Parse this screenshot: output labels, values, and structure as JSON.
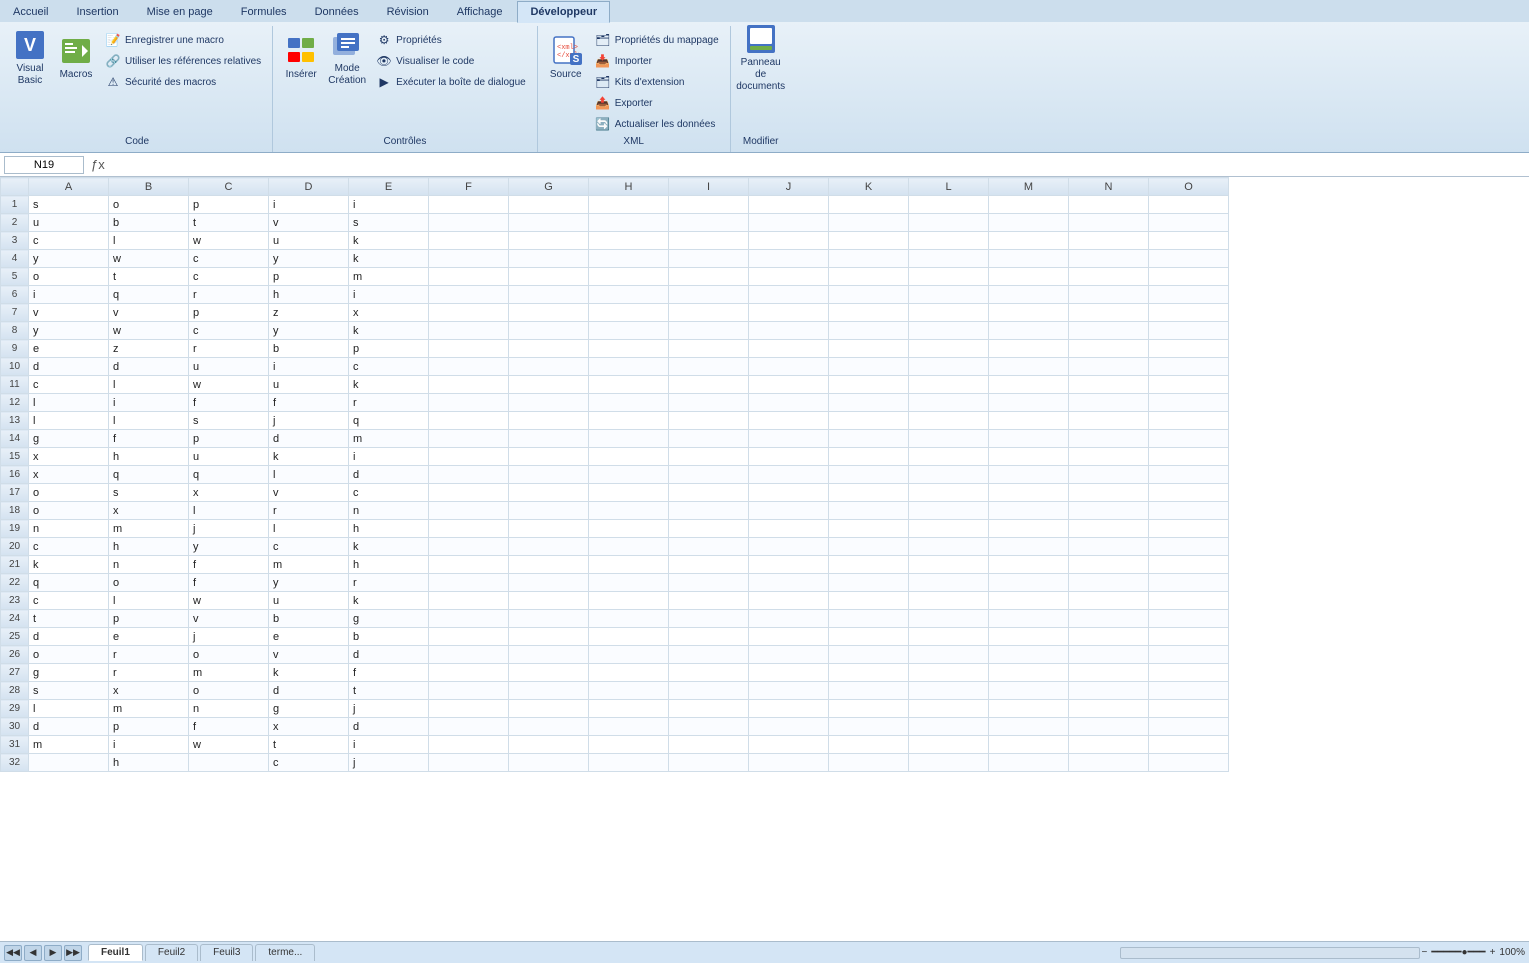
{
  "ribbon": {
    "tabs": [
      {
        "label": "Accueil",
        "active": false
      },
      {
        "label": "Insertion",
        "active": false
      },
      {
        "label": "Mise en page",
        "active": false
      },
      {
        "label": "Formules",
        "active": false
      },
      {
        "label": "Données",
        "active": false
      },
      {
        "label": "Révision",
        "active": false
      },
      {
        "label": "Affichage",
        "active": false
      },
      {
        "label": "Développeur",
        "active": true
      }
    ],
    "groups": [
      {
        "label": "Code",
        "large_buttons": [
          {
            "label": "Visual Basic",
            "icon": "🖥"
          },
          {
            "label": "Macros",
            "icon": "📋"
          }
        ],
        "small_buttons": [
          {
            "icon": "📝",
            "label": "Enregistrer une macro"
          },
          {
            "icon": "🔗",
            "label": "Utiliser les références relatives"
          },
          {
            "icon": "⚠",
            "label": "Sécurité des macros"
          }
        ]
      },
      {
        "label": "Contrôles",
        "large_buttons": [
          {
            "label": "Insérer",
            "icon": "⬜"
          },
          {
            "label": "Mode Création",
            "icon": "✏️"
          }
        ],
        "small_buttons": [
          {
            "icon": "⚙",
            "label": "Propriétés"
          },
          {
            "icon": "👁",
            "label": "Visualiser le code"
          },
          {
            "icon": "▶",
            "label": "Exécuter la boîte de dialogue"
          }
        ]
      },
      {
        "label": "XML",
        "large_buttons": [
          {
            "label": "Source",
            "icon": "📄"
          }
        ],
        "small_buttons": [
          {
            "icon": "🗂",
            "label": "Propriétés du mappage"
          },
          {
            "icon": "📥",
            "label": "Importer"
          },
          {
            "icon": "🗂",
            "label": "Kits d'extension"
          },
          {
            "icon": "📤",
            "label": "Exporter"
          },
          {
            "icon": "🔄",
            "label": "Actualiser les données"
          }
        ]
      },
      {
        "label": "Modifier",
        "large_buttons": [
          {
            "label": "Panneau de documents",
            "icon": "📋"
          }
        ],
        "small_buttons": []
      }
    ]
  },
  "formula_bar": {
    "cell_ref": "N19",
    "formula": ""
  },
  "columns": [
    "A",
    "B",
    "C",
    "D",
    "E",
    "F",
    "G",
    "H",
    "I",
    "J",
    "K",
    "L",
    "M",
    "N",
    "O"
  ],
  "rows": [
    {
      "num": 1,
      "cells": [
        "s",
        "o",
        "p",
        "i",
        "i",
        "",
        "",
        "",
        "",
        "",
        "",
        "",
        "",
        "",
        ""
      ]
    },
    {
      "num": 2,
      "cells": [
        "u",
        "b",
        "t",
        "v",
        "s",
        "",
        "",
        "",
        "",
        "",
        "",
        "",
        "",
        "",
        ""
      ]
    },
    {
      "num": 3,
      "cells": [
        "c",
        "l",
        "w",
        "u",
        "k",
        "",
        "",
        "",
        "",
        "",
        "",
        "",
        "",
        "",
        ""
      ]
    },
    {
      "num": 4,
      "cells": [
        "y",
        "w",
        "c",
        "y",
        "k",
        "",
        "",
        "",
        "",
        "",
        "",
        "",
        "",
        "",
        ""
      ]
    },
    {
      "num": 5,
      "cells": [
        "o",
        "t",
        "c",
        "p",
        "m",
        "",
        "",
        "",
        "",
        "",
        "",
        "",
        "",
        "",
        ""
      ]
    },
    {
      "num": 6,
      "cells": [
        "i",
        "q",
        "r",
        "h",
        "i",
        "",
        "",
        "",
        "",
        "",
        "",
        "",
        "",
        "",
        ""
      ]
    },
    {
      "num": 7,
      "cells": [
        "v",
        "v",
        "p",
        "z",
        "x",
        "",
        "",
        "",
        "",
        "",
        "",
        "",
        "",
        "",
        ""
      ]
    },
    {
      "num": 8,
      "cells": [
        "y",
        "w",
        "c",
        "y",
        "k",
        "",
        "",
        "",
        "",
        "",
        "",
        "",
        "",
        "",
        ""
      ]
    },
    {
      "num": 9,
      "cells": [
        "e",
        "z",
        "r",
        "b",
        "p",
        "",
        "",
        "",
        "",
        "",
        "",
        "",
        "",
        "",
        ""
      ]
    },
    {
      "num": 10,
      "cells": [
        "d",
        "d",
        "u",
        "i",
        "c",
        "",
        "",
        "",
        "",
        "",
        "",
        "",
        "",
        "",
        ""
      ]
    },
    {
      "num": 11,
      "cells": [
        "c",
        "l",
        "w",
        "u",
        "k",
        "",
        "",
        "",
        "",
        "",
        "",
        "",
        "",
        "",
        ""
      ]
    },
    {
      "num": 12,
      "cells": [
        "l",
        "i",
        "f",
        "f",
        "r",
        "",
        "",
        "",
        "",
        "",
        "",
        "",
        "",
        "",
        ""
      ]
    },
    {
      "num": 13,
      "cells": [
        "l",
        "l",
        "s",
        "j",
        "q",
        "",
        "",
        "",
        "",
        "",
        "",
        "",
        "",
        "",
        ""
      ]
    },
    {
      "num": 14,
      "cells": [
        "g",
        "f",
        "p",
        "d",
        "m",
        "",
        "",
        "",
        "",
        "",
        "",
        "",
        "",
        "",
        ""
      ]
    },
    {
      "num": 15,
      "cells": [
        "x",
        "h",
        "u",
        "k",
        "i",
        "",
        "",
        "",
        "",
        "",
        "",
        "",
        "",
        "",
        ""
      ]
    },
    {
      "num": 16,
      "cells": [
        "x",
        "q",
        "q",
        "l",
        "d",
        "",
        "",
        "",
        "",
        "",
        "",
        "",
        "",
        "",
        ""
      ]
    },
    {
      "num": 17,
      "cells": [
        "o",
        "s",
        "x",
        "v",
        "c",
        "",
        "",
        "",
        "",
        "",
        "",
        "",
        "",
        "",
        ""
      ]
    },
    {
      "num": 18,
      "cells": [
        "o",
        "x",
        "l",
        "r",
        "n",
        "",
        "",
        "",
        "",
        "",
        "",
        "",
        "",
        "",
        ""
      ]
    },
    {
      "num": 19,
      "cells": [
        "n",
        "m",
        "j",
        "l",
        "h",
        "",
        "",
        "",
        "",
        "",
        "",
        "",
        "",
        "",
        ""
      ]
    },
    {
      "num": 20,
      "cells": [
        "c",
        "h",
        "y",
        "c",
        "k",
        "",
        "",
        "",
        "",
        "",
        "",
        "",
        "",
        "",
        ""
      ]
    },
    {
      "num": 21,
      "cells": [
        "k",
        "n",
        "f",
        "m",
        "h",
        "",
        "",
        "",
        "",
        "",
        "",
        "",
        "",
        "",
        ""
      ]
    },
    {
      "num": 22,
      "cells": [
        "q",
        "o",
        "f",
        "y",
        "r",
        "",
        "",
        "",
        "",
        "",
        "",
        "",
        "",
        "",
        ""
      ]
    },
    {
      "num": 23,
      "cells": [
        "c",
        "l",
        "w",
        "u",
        "k",
        "",
        "",
        "",
        "",
        "",
        "",
        "",
        "",
        "",
        ""
      ]
    },
    {
      "num": 24,
      "cells": [
        "t",
        "p",
        "v",
        "b",
        "g",
        "",
        "",
        "",
        "",
        "",
        "",
        "",
        "",
        "",
        ""
      ]
    },
    {
      "num": 25,
      "cells": [
        "d",
        "e",
        "j",
        "e",
        "b",
        "",
        "",
        "",
        "",
        "",
        "",
        "",
        "",
        "",
        ""
      ]
    },
    {
      "num": 26,
      "cells": [
        "o",
        "r",
        "o",
        "v",
        "d",
        "",
        "",
        "",
        "",
        "",
        "",
        "",
        "",
        "",
        ""
      ]
    },
    {
      "num": 27,
      "cells": [
        "g",
        "r",
        "m",
        "k",
        "f",
        "",
        "",
        "",
        "",
        "",
        "",
        "",
        "",
        "",
        ""
      ]
    },
    {
      "num": 28,
      "cells": [
        "s",
        "x",
        "o",
        "d",
        "t",
        "",
        "",
        "",
        "",
        "",
        "",
        "",
        "",
        "",
        ""
      ]
    },
    {
      "num": 29,
      "cells": [
        "l",
        "m",
        "n",
        "g",
        "j",
        "",
        "",
        "",
        "",
        "",
        "",
        "",
        "",
        "",
        ""
      ]
    },
    {
      "num": 30,
      "cells": [
        "d",
        "p",
        "f",
        "x",
        "d",
        "",
        "",
        "",
        "",
        "",
        "",
        "",
        "",
        "",
        ""
      ]
    },
    {
      "num": 31,
      "cells": [
        "m",
        "i",
        "w",
        "t",
        "i",
        "",
        "",
        "",
        "",
        "",
        "",
        "",
        "",
        "",
        ""
      ]
    },
    {
      "num": 32,
      "cells": [
        "",
        "h",
        "",
        "c",
        "j",
        "",
        "",
        "",
        "",
        "",
        "",
        "",
        "",
        "",
        ""
      ]
    }
  ],
  "sheet_tabs": [
    {
      "label": "Feuil1",
      "active": true
    },
    {
      "label": "Feuil2",
      "active": false
    },
    {
      "label": "Feuil3",
      "active": false
    },
    {
      "label": "terme...",
      "active": false
    }
  ],
  "colors": {
    "ribbon_bg": "#cee0ef",
    "header_bg": "#d4e5f5",
    "grid_border": "#d0dde8",
    "accent": "#1f3864"
  }
}
